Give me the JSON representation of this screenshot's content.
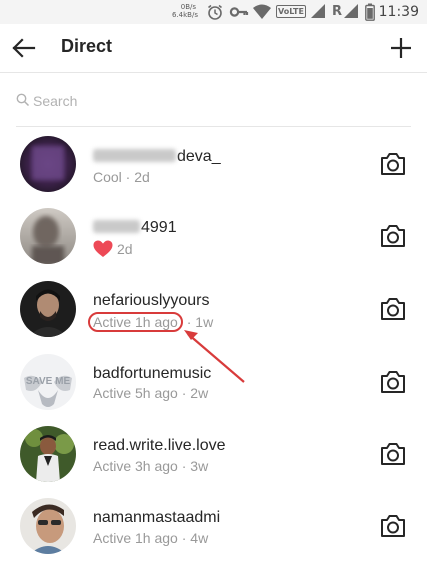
{
  "status_bar": {
    "net_rate_top": "0B/s",
    "net_rate_bottom": "6.4kB/s",
    "volte": "VoLTE",
    "roaming": "R",
    "time": "11:39",
    "icons": [
      "alarm-icon",
      "key-icon",
      "wifi-icon",
      "volte-icon",
      "signal-icon",
      "roaming-signal-icon",
      "battery-icon"
    ]
  },
  "header": {
    "title": "Direct"
  },
  "search": {
    "placeholder": "Search"
  },
  "threads": [
    {
      "name": "deva_",
      "name_obscured": true,
      "status": "Cool",
      "time": "2d"
    },
    {
      "name": "4991",
      "name_obscured": true,
      "status": "heart",
      "time": "2d"
    },
    {
      "name": "nefariouslyyours",
      "status": "Active 1h ago",
      "time": "1w",
      "highlighted": true
    },
    {
      "name": "badfortunemusic",
      "status": "Active 5h ago",
      "time": "2w"
    },
    {
      "name": "read.write.live.love",
      "status": "Active 3h ago",
      "time": "3w"
    },
    {
      "name": "namanmastaadmi",
      "status": "Active 1h ago",
      "time": "4w"
    }
  ],
  "avatar_badge_text": "SAVE ME",
  "annotation": {
    "color": "#d83b3b"
  },
  "colors": {
    "text": "#262626",
    "muted": "#999999",
    "heart": "#ed4956",
    "divider": "#e6e6e6"
  }
}
